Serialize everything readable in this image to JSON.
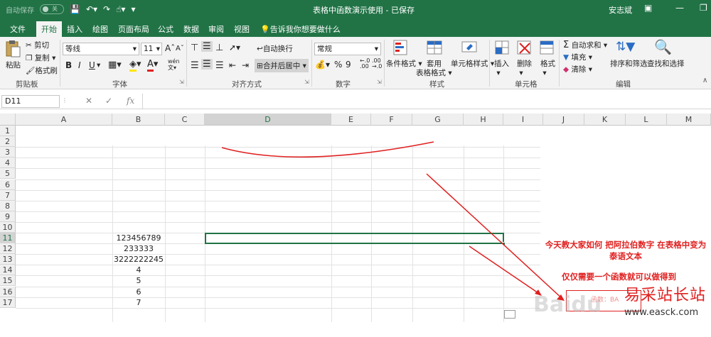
{
  "titlebar": {
    "autosave_label": "自动保存",
    "autosave_state": "关",
    "doc_title": "表格中函数演示使用 - 已保存",
    "user": "安志斌"
  },
  "tabs": [
    "文件",
    "开始",
    "插入",
    "绘图",
    "页面布局",
    "公式",
    "数据",
    "审阅",
    "视图"
  ],
  "active_tab": "开始",
  "tell_me": "告诉我你想要做什么",
  "ribbon": {
    "clipboard": {
      "paste": "粘贴",
      "cut": "剪切",
      "copy": "复制",
      "painter": "格式刷",
      "label": "剪贴板"
    },
    "font": {
      "name": "等线",
      "size": "11",
      "grow": "A",
      "shrink": "A",
      "bold": "B",
      "italic": "I",
      "underline": "U",
      "label": "字体",
      "phonetic": "wén"
    },
    "alignment": {
      "wrap": "自动换行",
      "merge": "合并后居中",
      "label": "对齐方式"
    },
    "number": {
      "format": "常规",
      "percent": "%",
      "comma": "9",
      "label": "数字"
    },
    "styles": {
      "conditional": "条件格式",
      "table_line1": "套用",
      "table_line2": "表格格式",
      "cell_styles": "单元格样式",
      "label": "样式"
    },
    "cells": {
      "insert": "插入",
      "delete": "删除",
      "format": "格式",
      "label": "单元格"
    },
    "editing": {
      "autosum": "自动求和",
      "fill": "填充",
      "clear": "清除",
      "sort": "排序和筛选",
      "find": "查找和选择",
      "label": "编辑"
    }
  },
  "formula_bar": {
    "name_box": "D11",
    "fx": "fx",
    "value": ""
  },
  "columns": [
    "A",
    "B",
    "C",
    "D",
    "E",
    "F",
    "G",
    "H",
    "I",
    "J",
    "K",
    "L",
    "M"
  ],
  "selected_column": "D",
  "rows": [
    "1",
    "2",
    "3",
    "4",
    "5",
    "6",
    "7",
    "8",
    "9",
    "10",
    "11",
    "12",
    "13",
    "14",
    "15",
    "16",
    "17"
  ],
  "selected_row": "11",
  "cells_b": [
    {
      "row": "11",
      "value": "123456789"
    },
    {
      "row": "12",
      "value": "233333"
    },
    {
      "row": "13",
      "value": "3222222245"
    },
    {
      "row": "14",
      "value": "4"
    },
    {
      "row": "15",
      "value": "5"
    },
    {
      "row": "16",
      "value": "6"
    },
    {
      "row": "17",
      "value": "7"
    }
  ],
  "annotation": {
    "note1": "今天教大家如何 把阿拉伯数字 在表格中变为泰语文本",
    "note2": "仅仅需要一个函数就可以做得到",
    "box_text": "函数：BA"
  },
  "watermark": {
    "brand": "易采站长站",
    "url": "www.easck.com",
    "baidu": "Baidu"
  },
  "colors": {
    "excel_green": "#217346",
    "annotation_red": "#e02020"
  }
}
